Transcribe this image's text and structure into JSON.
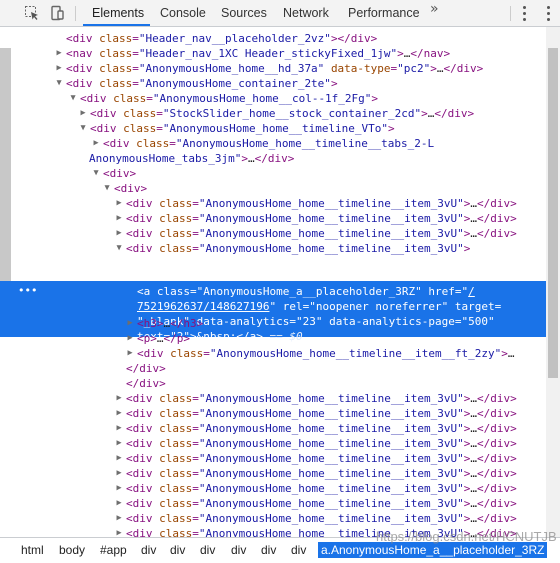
{
  "toolbar": {
    "tabs": [
      "Elements",
      "Console",
      "Sources",
      "Network",
      "Performance"
    ],
    "more": "»"
  },
  "tree": [
    {
      "h": "<span class='tag'>&lt;div </span><span class='an'>class</span><span class='tag'>=</span><span class='av'>\"Header_nav__placeholder_2vz\"</span><span class='tag'>&gt;&lt;/div&gt;</span>"
    },
    {
      "h": "<span class='tag'>&lt;nav </span><span class='an'>class</span><span class='tag'>=</span><span class='av'>\"Header_nav_1XC Header_stickyFixed_1jw\"</span><span class='tag'>&gt;</span><span class='txt'>…</span><span class='tag'>&lt;/nav&gt;</span>"
    },
    {
      "h": "<span class='tag'>&lt;div </span><span class='an'>class</span><span class='tag'>=</span><span class='av'>\"AnonymousHome_home__hd_37a\"</span> <span class='an'>data-type</span><span class='tag'>=</span><span class='av'>\"pc2\"</span><span class='tag'>&gt;</span><span class='txt'>…</span><span class='tag'>&lt;/div&gt;</span>"
    },
    {
      "h": "<span class='tag'>&lt;div </span><span class='an'>class</span><span class='tag'>=</span><span class='av'>\"AnonymousHome_container_2te\"</span><span class='tag'>&gt;</span>"
    },
    {
      "h": "<span class='tag'>&lt;div </span><span class='an'>class</span><span class='tag'>=</span><span class='av'>\"AnonymousHome_home__col--1f_2Fg\"</span><span class='tag'>&gt;</span>"
    },
    {
      "h": "<span class='tag'>&lt;div </span><span class='an'>class</span><span class='tag'>=</span><span class='av'>\"StockSlider_home__stock_container_2cd\"</span><span class='tag'>&gt;</span><span class='txt'>…</span><span class='tag'>&lt;/div&gt;</span>"
    },
    {
      "h": "<span class='tag'>&lt;div </span><span class='an'>class</span><span class='tag'>=</span><span class='av'>\"AnonymousHome_home__timeline_VTo\"</span><span class='tag'>&gt;</span>"
    },
    {
      "h": "<span class='tag'>&lt;div </span><span class='an'>class</span><span class='tag'>=</span><span class='av'>\"AnonymousHome_home__timeline__tabs_2-L</span>"
    },
    {
      "h": "<span class='av'>AnonymousHome_tabs_3jm\"</span><span class='tag'>&gt;</span><span class='txt'>…</span><span class='tag'>&lt;/div&gt;</span>"
    },
    {
      "h": "<span class='tag'>&lt;div&gt;</span>"
    },
    {
      "h": "<span class='tag'>&lt;div&gt;</span>"
    },
    {
      "h": "<span class='tag'>&lt;div </span><span class='an'>class</span><span class='tag'>=</span><span class='av'>\"AnonymousHome_home__timeline__item_3vU\"</span><span class='tag'>&gt;</span><span class='txt'>…</span><span class='tag'>&lt;/div&gt;</span>"
    },
    {
      "h": "<span class='tag'>&lt;div </span><span class='an'>class</span><span class='tag'>=</span><span class='av'>\"AnonymousHome_home__timeline__item_3vU\"</span><span class='tag'>&gt;</span><span class='txt'>…</span><span class='tag'>&lt;/div&gt;</span>"
    },
    {
      "h": "<span class='tag'>&lt;div </span><span class='an'>class</span><span class='tag'>=</span><span class='av'>\"AnonymousHome_home__timeline__item_3vU\"</span><span class='tag'>&gt;</span><span class='txt'>…</span><span class='tag'>&lt;/div&gt;</span>"
    },
    {
      "h": "<span class='tag'>&lt;div </span><span class='an'>class</span><span class='tag'>=</span><span class='av'>\"AnonymousHome_home__timeline__item_3vU\"</span><span class='tag'>&gt;</span>"
    },
    {
      "h": "<span class='tag'>&lt;a </span><span class='an'>class</span><span class='tag'>=</span><span class='av'>\"AnonymousHome_a__placeholder_3RZ\"</span> <span class='an'>href</span><span class='tag'>=</span><span class='av'>\"<span class='link'>/</span></span>"
    },
    {
      "h": "<span class='av link'>7521962637/148627196</span><span class='av'>\"</span> <span class='an'>rel</span><span class='tag'>=</span><span class='av'>\"noopener noreferrer\"</span> <span class='an'>target</span><span class='tag'>=</span>"
    },
    {
      "h": "<span class='av'>\"_blank\"</span> <span class='an'>data-analytics</span><span class='tag'>=</span><span class='av'>\"23\"</span> <span class='an'>data-analytics-page</span><span class='tag'>=</span><span class='av'>\"500\"</span>"
    },
    {
      "h": "<span class='an'>text</span><span class='tag'>=</span><span class='av'>\"2\"</span><span class='tag'>&gt;</span><span class='txt'>&amp;nbsp;</span><span class='tag'>&lt;/a&gt;</span> <span class='dim'>== $0</span>"
    },
    {
      "h": "<span class='tag'>&lt;h3&gt;</span><span class='txt'>…</span><span class='tag'>&lt;/h3&gt;</span>"
    },
    {
      "h": "<span class='tag'>&lt;p&gt;</span><span class='txt'>…</span><span class='tag'>&lt;/p&gt;</span>"
    },
    {
      "h": "<span class='tag'>&lt;div </span><span class='an'>class</span><span class='tag'>=</span><span class='av'>\"AnonymousHome_home__timeline__item__ft_2zy\"</span><span class='tag'>&gt;</span><span class='txt'>…</span>"
    },
    {
      "h": "<span class='tag'>&lt;/div&gt;</span>"
    },
    {
      "h": "<span class='tag'>&lt;/div&gt;</span>"
    },
    {
      "h": "<span class='tag'>&lt;div </span><span class='an'>class</span><span class='tag'>=</span><span class='av'>\"AnonymousHome_home__timeline__item_3vU\"</span><span class='tag'>&gt;</span><span class='txt'>…</span><span class='tag'>&lt;/div&gt;</span>"
    },
    {
      "h": "<span class='tag'>&lt;div </span><span class='an'>class</span><span class='tag'>=</span><span class='av'>\"AnonymousHome_home__timeline__item_3vU\"</span><span class='tag'>&gt;</span><span class='txt'>…</span><span class='tag'>&lt;/div&gt;</span>"
    },
    {
      "h": "<span class='tag'>&lt;div </span><span class='an'>class</span><span class='tag'>=</span><span class='av'>\"AnonymousHome_home__timeline__item_3vU\"</span><span class='tag'>&gt;</span><span class='txt'>…</span><span class='tag'>&lt;/div&gt;</span>"
    },
    {
      "h": "<span class='tag'>&lt;div </span><span class='an'>class</span><span class='tag'>=</span><span class='av'>\"AnonymousHome_home__timeline__item_3vU\"</span><span class='tag'>&gt;</span><span class='txt'>…</span><span class='tag'>&lt;/div&gt;</span>"
    },
    {
      "h": "<span class='tag'>&lt;div </span><span class='an'>class</span><span class='tag'>=</span><span class='av'>\"AnonymousHome_home__timeline__item_3vU\"</span><span class='tag'>&gt;</span><span class='txt'>…</span><span class='tag'>&lt;/div&gt;</span>"
    },
    {
      "h": "<span class='tag'>&lt;div </span><span class='an'>class</span><span class='tag'>=</span><span class='av'>\"AnonymousHome_home__timeline__item_3vU\"</span><span class='tag'>&gt;</span><span class='txt'>…</span><span class='tag'>&lt;/div&gt;</span>"
    },
    {
      "h": "<span class='tag'>&lt;div </span><span class='an'>class</span><span class='tag'>=</span><span class='av'>\"AnonymousHome_home__timeline__item_3vU\"</span><span class='tag'>&gt;</span><span class='txt'>…</span><span class='tag'>&lt;/div&gt;</span>"
    },
    {
      "h": "<span class='tag'>&lt;div </span><span class='an'>class</span><span class='tag'>=</span><span class='av'>\"AnonymousHome_home__timeline__item_3vU\"</span><span class='tag'>&gt;</span><span class='txt'>…</span><span class='tag'>&lt;/div&gt;</span>"
    },
    {
      "h": "<span class='tag'>&lt;div </span><span class='an'>class</span><span class='tag'>=</span><span class='av'>\"AnonymousHome_home__timeline__item_3vU\"</span><span class='tag'>&gt;</span><span class='txt'>…</span><span class='tag'>&lt;/div&gt;</span>"
    },
    {
      "h": "<span class='tag'>&lt;div </span><span class='an'>class</span><span class='tag'>=</span><span class='av'>\"AnonymousHome_home__timeline__item_3vU\"</span><span class='tag'>&gt;</span><span class='txt'>…</span><span class='tag'>&lt;/div&gt;</span>"
    }
  ],
  "selected_gutter": "•••",
  "breadcrumb": [
    "html",
    "body",
    "#app",
    "div",
    "div",
    "div",
    "div",
    "div",
    "a.AnonymousHome_a__placeholder_3RZ"
  ],
  "watermark": "https://blog.csdn.net/HCNUTJB",
  "colors": {
    "accent": "#1a73e8",
    "tag": "#881280",
    "attr_name": "#994500",
    "attr_value": "#1a1aa6"
  }
}
